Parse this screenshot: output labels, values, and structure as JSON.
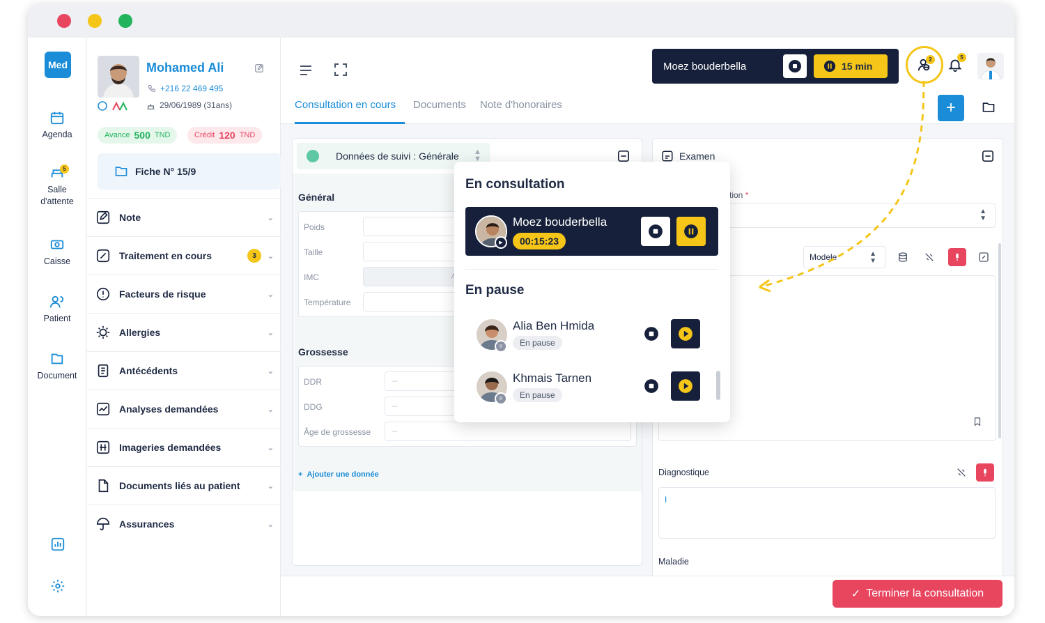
{
  "window": {
    "dot_colors": [
      "#e8455f",
      "#f5c518",
      "#22b35d"
    ]
  },
  "app": {
    "logo": "Med",
    "brand_color": "#1a8cd8",
    "accent_yellow": "#f5c518",
    "dark_navy": "#16203a",
    "danger": "#e8455f"
  },
  "rail": {
    "items": [
      {
        "label": "Agenda",
        "icon": "calendar-icon"
      },
      {
        "label": "Salle d'attente",
        "icon": "waiting-room-icon",
        "badge": "5"
      },
      {
        "label": "Caisse",
        "icon": "cash-icon"
      },
      {
        "label": "Patient",
        "icon": "patients-icon"
      },
      {
        "label": "Document",
        "icon": "document-icon"
      }
    ],
    "bottom_icons": [
      "stats-icon",
      "settings-icon"
    ]
  },
  "patient": {
    "name": "Mohamed Ali",
    "phone": "+216 22 469 495",
    "birth": "29/06/1989 (31ans)",
    "avance_label": "Avance",
    "avance_value": "500",
    "avance_unit": "TND",
    "credit_label": "Crédit",
    "credit_value": "120",
    "credit_unit": "TND",
    "fiche": "Fiche N° 15/9",
    "sections": [
      {
        "label": "Note",
        "icon": "note-icon"
      },
      {
        "label": "Traitement en cours",
        "icon": "pill-icon",
        "count": "3"
      },
      {
        "label": "Facteurs de risque",
        "icon": "alert-icon"
      },
      {
        "label": "Allergies",
        "icon": "allergy-icon"
      },
      {
        "label": "Antécédents",
        "icon": "history-icon"
      },
      {
        "label": "Analyses demandées",
        "icon": "analysis-icon"
      },
      {
        "label": "Imageries demandées",
        "icon": "imaging-icon"
      },
      {
        "label": "Documents liés au patient",
        "icon": "file-icon"
      },
      {
        "label": "Assurances",
        "icon": "umbrella-icon"
      }
    ]
  },
  "topbar": {
    "current_patient": "Moez bouderbella",
    "timer_label": "15 min",
    "consult_badge": "2",
    "notif_badge": "5"
  },
  "tabs": [
    "Consultation en cours",
    "Documents",
    "Note d'honoraires"
  ],
  "suivi": {
    "header": "Données de suivi : Générale",
    "general_title": "Général",
    "general_fields": [
      "Poids",
      "Taille",
      "IMC",
      "Température"
    ],
    "placeholder": "--",
    "imc_placeholder": "Auto",
    "grossesse_title": "Grossesse",
    "grossesse_fields": [
      "DDR",
      "DDG",
      "Âge de grossesse"
    ],
    "add_link": "Ajouter une donnée"
  },
  "examen": {
    "title": "Examen",
    "motif_label_partial": "tion",
    "modele_label": "Modele",
    "diagnostique_label": "Diagnostique",
    "diagnostique_value": "I",
    "maladie_label": "Maladie"
  },
  "popover": {
    "title_active": "En consultation",
    "active": {
      "name": "Moez bouderbella",
      "timer": "00:15:23"
    },
    "title_paused": "En pause",
    "paused": [
      {
        "name": "Alia Ben Hmida",
        "status": "En pause"
      },
      {
        "name": "Khmais Tarnen",
        "status": "En pause"
      }
    ]
  },
  "actions": {
    "terminate": "Terminer la consultation"
  }
}
